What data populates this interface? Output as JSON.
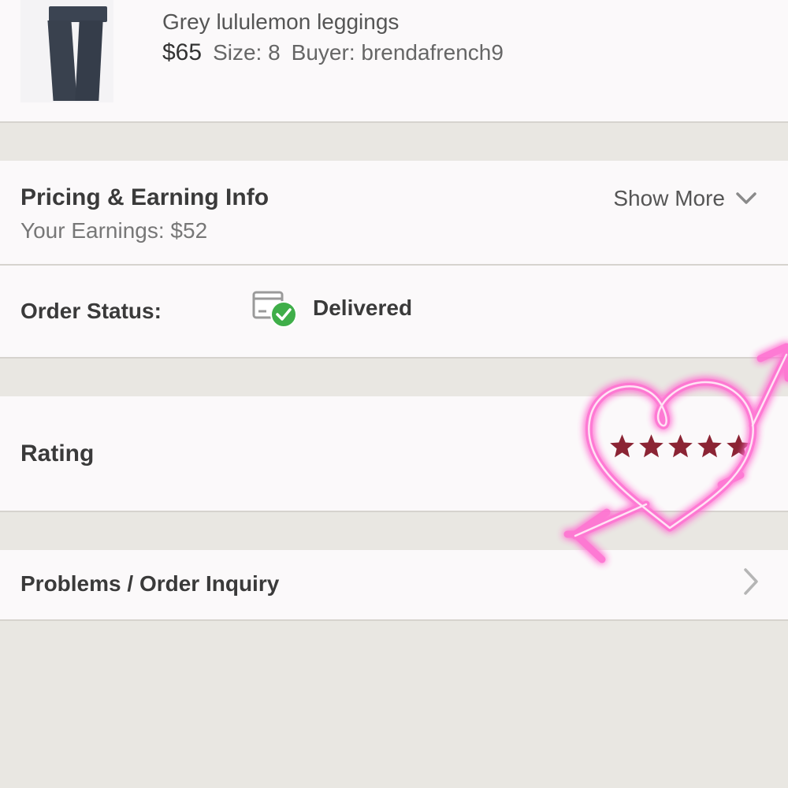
{
  "product": {
    "title": "Grey lululemon leggings",
    "price": "$65",
    "size": "Size: 8",
    "buyer": "Buyer: brendafrench9"
  },
  "pricing": {
    "title": "Pricing & Earning Info",
    "earnings": "Your Earnings: $52",
    "show_more": "Show More"
  },
  "order_status": {
    "label": "Order Status:",
    "value": "Delivered"
  },
  "rating": {
    "label": "Rating",
    "stars": 5,
    "star_color": "#8b2434"
  },
  "problems": {
    "label": "Problems / Order Inquiry"
  },
  "colors": {
    "background": "#e9e7e2",
    "card": "#fbf9fa",
    "delivered_check": "#3fae49",
    "neon_pink": "#ff6fd1"
  },
  "icons": {
    "show_more": "chevron-down-icon",
    "status": "package-delivered-icon",
    "problems": "chevron-right-icon",
    "sticker": "heart-arrow-sticker"
  }
}
